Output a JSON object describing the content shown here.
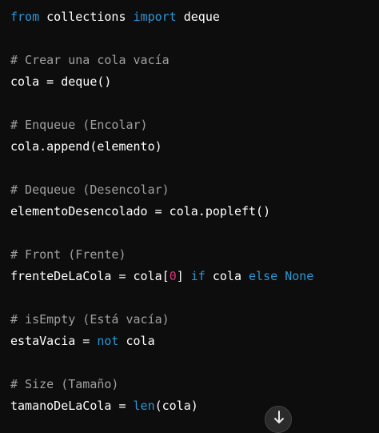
{
  "code": {
    "language": "python",
    "lines": [
      [
        {
          "t": "from",
          "k": "kw"
        },
        {
          "t": " collections ",
          "k": "txt"
        },
        {
          "t": "import",
          "k": "kw"
        },
        {
          "t": " deque",
          "k": "txt"
        }
      ],
      [],
      [
        {
          "t": "# Crear una cola vacía",
          "k": "cm"
        }
      ],
      [
        {
          "t": "cola = deque()",
          "k": "txt"
        }
      ],
      [],
      [
        {
          "t": "# Enqueue (Encolar)",
          "k": "cm"
        }
      ],
      [
        {
          "t": "cola.append(elemento)",
          "k": "txt"
        }
      ],
      [],
      [
        {
          "t": "# Dequeue (Desencolar)",
          "k": "cm"
        }
      ],
      [
        {
          "t": "elementoDesencolado = cola.popleft()",
          "k": "txt"
        }
      ],
      [],
      [
        {
          "t": "# Front (Frente)",
          "k": "cm"
        }
      ],
      [
        {
          "t": "frenteDeLaCola = cola[",
          "k": "txt"
        },
        {
          "t": "0",
          "k": "num"
        },
        {
          "t": "] ",
          "k": "txt"
        },
        {
          "t": "if",
          "k": "kw"
        },
        {
          "t": " cola ",
          "k": "txt"
        },
        {
          "t": "else",
          "k": "kw"
        },
        {
          "t": " ",
          "k": "txt"
        },
        {
          "t": "None",
          "k": "kw"
        }
      ],
      [],
      [
        {
          "t": "# isEmpty (Está vacía)",
          "k": "cm"
        }
      ],
      [
        {
          "t": "estaVacia = ",
          "k": "txt"
        },
        {
          "t": "not",
          "k": "kw"
        },
        {
          "t": " cola",
          "k": "txt"
        }
      ],
      [],
      [
        {
          "t": "# Size (Tamaño)",
          "k": "cm"
        }
      ],
      [
        {
          "t": "tamanoDeLaCola = ",
          "k": "txt"
        },
        {
          "t": "len",
          "k": "kw"
        },
        {
          "t": "(cola)",
          "k": "txt"
        }
      ]
    ]
  },
  "colors": {
    "background": "#0d0d0d",
    "keyword": "#2e95d3",
    "comment": "#a0a0a0",
    "number": "#df3079",
    "text": "#ffffff"
  },
  "scroll_button": {
    "icon": "arrow-down-icon"
  }
}
